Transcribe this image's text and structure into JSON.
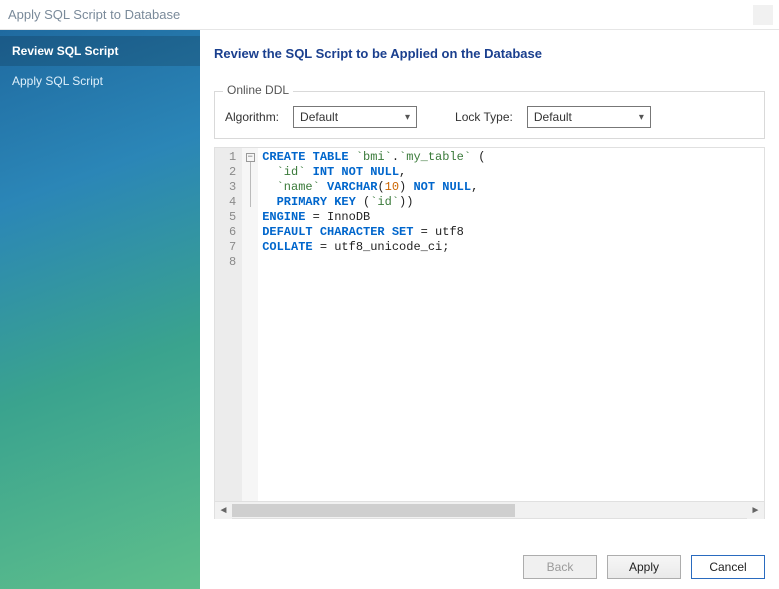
{
  "window": {
    "title": "Apply SQL Script to Database"
  },
  "sidebar": {
    "items": [
      {
        "label": "Review SQL Script",
        "active": true
      },
      {
        "label": "Apply SQL Script",
        "active": false
      }
    ]
  },
  "heading": "Review the SQL Script to be Applied on the Database",
  "onlineDDL": {
    "legend": "Online DDL",
    "algorithmLabel": "Algorithm:",
    "algorithmValue": "Default",
    "lockTypeLabel": "Lock Type:",
    "lockTypeValue": "Default"
  },
  "editor": {
    "lineNumbers": [
      "1",
      "2",
      "3",
      "4",
      "5",
      "6",
      "7",
      "8"
    ],
    "lines": [
      [
        {
          "cls": "kw",
          "t": "CREATE TABLE "
        },
        {
          "cls": "ident",
          "t": "`bmi`"
        },
        {
          "cls": "plain",
          "t": "."
        },
        {
          "cls": "ident",
          "t": "`my_table`"
        },
        {
          "cls": "plain",
          "t": " ("
        }
      ],
      [
        {
          "cls": "plain",
          "t": "  "
        },
        {
          "cls": "ident",
          "t": "`id`"
        },
        {
          "cls": "kw",
          "t": " INT NOT NULL"
        },
        {
          "cls": "plain",
          "t": ","
        }
      ],
      [
        {
          "cls": "plain",
          "t": "  "
        },
        {
          "cls": "ident",
          "t": "`name`"
        },
        {
          "cls": "kw",
          "t": " VARCHAR"
        },
        {
          "cls": "plain",
          "t": "("
        },
        {
          "cls": "num",
          "t": "10"
        },
        {
          "cls": "plain",
          "t": ")"
        },
        {
          "cls": "kw",
          "t": " NOT NULL"
        },
        {
          "cls": "plain",
          "t": ","
        }
      ],
      [
        {
          "cls": "plain",
          "t": "  "
        },
        {
          "cls": "kw",
          "t": "PRIMARY KEY"
        },
        {
          "cls": "plain",
          "t": " ("
        },
        {
          "cls": "ident",
          "t": "`id`"
        },
        {
          "cls": "plain",
          "t": "))"
        }
      ],
      [
        {
          "cls": "kw",
          "t": "ENGINE"
        },
        {
          "cls": "plain",
          "t": " = "
        },
        {
          "cls": "plain",
          "t": "InnoDB"
        }
      ],
      [
        {
          "cls": "kw",
          "t": "DEFAULT CHARACTER SET"
        },
        {
          "cls": "plain",
          "t": " = utf8"
        }
      ],
      [
        {
          "cls": "kw",
          "t": "COLLATE"
        },
        {
          "cls": "plain",
          "t": " = utf8_unicode_ci;"
        }
      ],
      []
    ]
  },
  "buttons": {
    "back": "Back",
    "apply": "Apply",
    "cancel": "Cancel"
  }
}
